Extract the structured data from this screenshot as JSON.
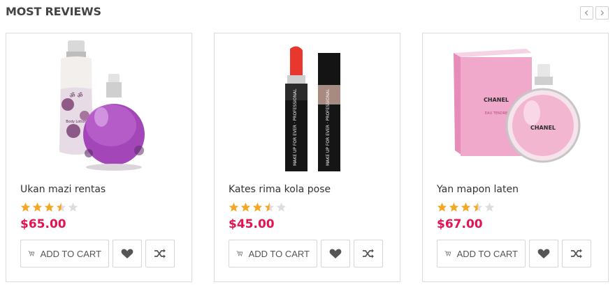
{
  "section": {
    "title": "MOST REVIEWS"
  },
  "products": [
    {
      "name": "Ukan mazi rentas",
      "rating": 3.5,
      "price": "$65.00",
      "cart_label": "ADD TO CART",
      "image_label": "Body Lotion",
      "image_brand": "ॐ ॐ"
    },
    {
      "name": "Kates rima kola pose",
      "rating": 3.5,
      "price": "$45.00",
      "cart_label": "ADD TO CART",
      "image_label": "MAKE UP FOR EVER · PROFESSIONAL"
    },
    {
      "name": "Yan mapon laten",
      "rating": 3.5,
      "price": "$67.00",
      "cart_label": "ADD TO CART",
      "image_label": "CHANEL",
      "image_sub": "EAU TENDRE"
    }
  ],
  "colors": {
    "star_filled": "#f5a623",
    "star_empty": "#dddddd",
    "price": "#e5134f"
  },
  "icons": {
    "prev": "chevron-left-icon",
    "next": "chevron-right-icon",
    "cart": "cart-icon",
    "wishlist": "heart-icon",
    "compare": "shuffle-icon"
  }
}
